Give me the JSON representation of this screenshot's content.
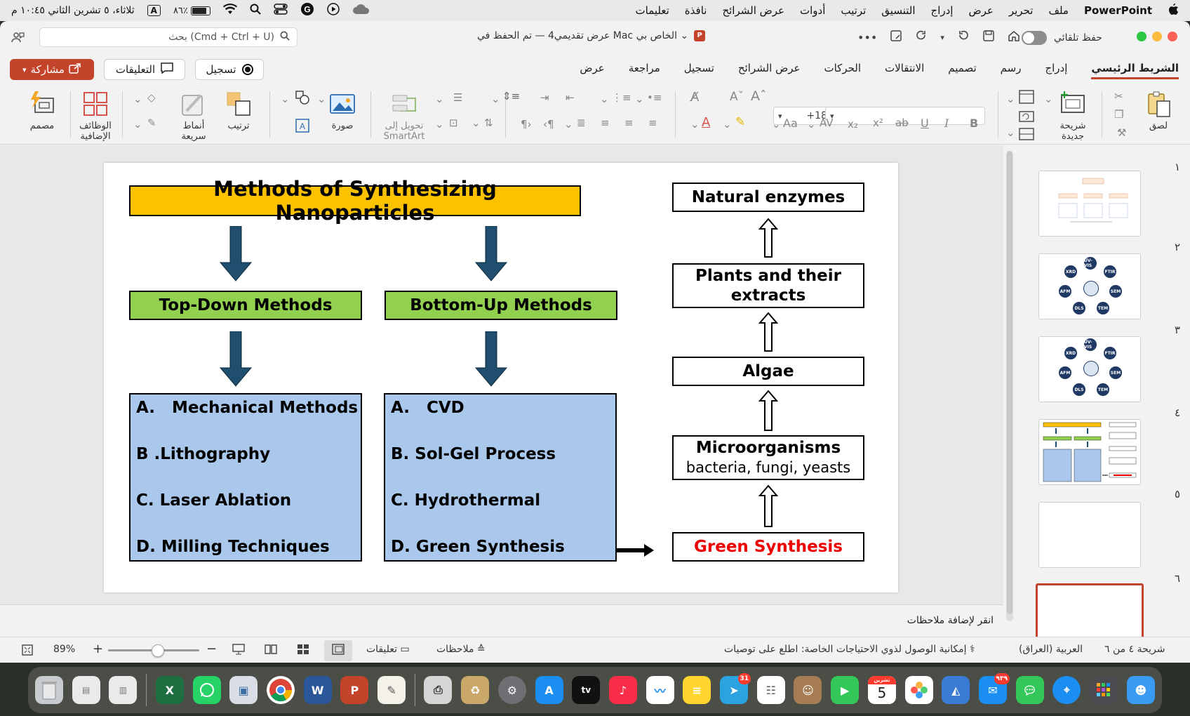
{
  "menubar": {
    "app_name": "PowerPoint",
    "menus": [
      "ملف",
      "تحرير",
      "عرض",
      "إدراج",
      "التنسيق",
      "ترتيب",
      "أدوات",
      "عرض الشرائح",
      "نافذة",
      "تعليمات"
    ],
    "battery": "٨٦٪",
    "input_indicator": "A",
    "clock": "ثلاثاء، ٥ تشرين الثاني ١٠:٤٥ م"
  },
  "titlebar": {
    "search_placeholder": "بحث (Cmd + Ctrl + U)",
    "doc_title": "عرض تقديمي4 — تم الحفظ في Mac الخاص بي ⌄",
    "autosave_label": "حفظ تلقائي",
    "more": "•••"
  },
  "tabs": [
    "الشريط الرئيسي",
    "إدراج",
    "رسم",
    "تصميم",
    "الانتقالات",
    "الحركات",
    "عرض الشرائح",
    "تسجيل",
    "مراجعة",
    "عرض"
  ],
  "active_tab": "الشريط الرئيسي",
  "actions": {
    "share": "مشاركة",
    "comments": "التعليقات",
    "record": "تسجيل"
  },
  "ribbon": {
    "paste": "لصق",
    "new_slide": "شريحة جديدة",
    "font_size": "+18",
    "smartart": "تحويل إلى SmartArt",
    "picture": "صورة",
    "arrange": "ترتيب",
    "quick_styles": "أنماط سريعة",
    "addins": "الوظائف الإضافية",
    "designer": "مصمم"
  },
  "slide": {
    "title": "Methods of Synthesizing Nanoparticles",
    "top_down": "Top-Down Methods",
    "bottom_up": "Bottom-Up Methods",
    "top_down_items": [
      "A.   Mechanical Methods",
      "B .Lithography",
      "C. Laser Ablation",
      "D. Milling Techniques"
    ],
    "bottom_up_items": [
      "A.   CVD",
      "B. Sol-Gel Process",
      "C. Hydrothermal",
      "D. Green Synthesis"
    ],
    "green_chain": {
      "natural_enzymes": "Natural enzymes",
      "plants": "Plants and their extracts",
      "algae": "Algae",
      "microorganisms": "Microorganisms",
      "microorganisms_sub": "bacteria, fungi, yeasts",
      "green_synthesis": "Green Synthesis"
    }
  },
  "notes_placeholder": "انقر لإضافة ملاحظات",
  "thumbnails": {
    "numbers": [
      "١",
      "٢",
      "٣",
      "٤",
      "٥",
      "٦"
    ],
    "selected_index": 6,
    "circle_labels": [
      "UV-VIS",
      "FTIR",
      "SEM",
      "TEM",
      "DLS",
      "AFM",
      "XRD"
    ]
  },
  "statusbar": {
    "slide_of": "شريحة ٤ من ٦",
    "language": "العربية (العراق)",
    "accessibility": "إمكانية الوصول لذوي الاحتياجات الخاصة: اطلع على توصيات",
    "notes": "ملاحظات",
    "comments": "تعليقات",
    "zoom": "89%"
  },
  "dock": {
    "telegram_badge": "31",
    "mail_badge": "٩٣٩",
    "calendar_month": "تشرين الثاني",
    "calendar_day": "5"
  },
  "colors": {
    "accent": "#c4442b",
    "title_fill": "#fcc200",
    "green_fill": "#92d050",
    "list_fill": "#a9c8ec",
    "arrow_fill": "#1f4e6e",
    "green_synthesis_text": "#ee0000"
  }
}
